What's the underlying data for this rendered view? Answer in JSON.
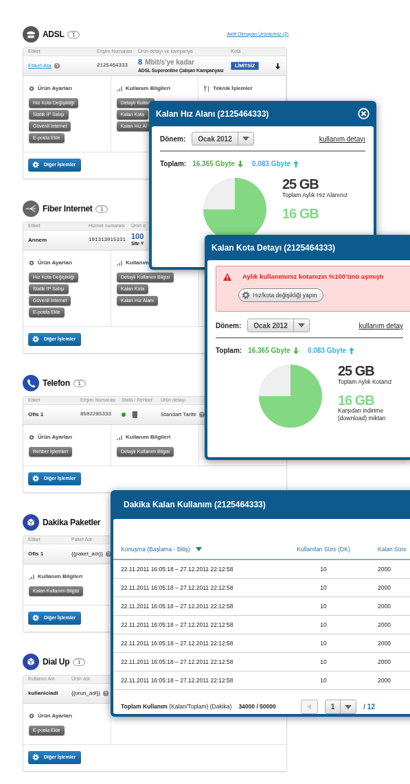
{
  "sections": [
    {
      "kind": "adsl",
      "title": "ADSL",
      "count": "1",
      "link": "Aktif Olmayan Ürünleriniz (3)",
      "columns": [
        "Etiket",
        "Erişim Numarası",
        "Ürün detayı ve kampanya",
        "Kota"
      ],
      "cells": [
        {
          "kind": "link",
          "text": "Etiket Ata",
          "help": true
        },
        {
          "kind": "number",
          "text": "2125464333"
        },
        {
          "kind": "speed",
          "value": "8",
          "unit": "Mbit/s'ye kadar",
          "campaign": "ADSL Superonline Çalışan Kampanyası"
        },
        {
          "kind": "badge",
          "text": "LİMİTSİZ"
        },
        {
          "kind": "expand"
        }
      ],
      "groups": [
        {
          "kind": "settings",
          "title": "Ürün Ayarları",
          "buttons": [
            "Hız Kota Değişikliği",
            "Statik IP Satışı",
            "Güvenli Internet",
            "E-posta Ekle"
          ]
        },
        {
          "kind": "usage",
          "title": "Kullanım Bilgileri",
          "buttons": [
            "Detaylı Kullan",
            "Kalan Kota",
            "Kalan Hız Al"
          ]
        },
        {
          "kind": "tech",
          "title": "Teknik İşlemler"
        }
      ],
      "footer_button": "Diğer İşlemler"
    },
    {
      "kind": "fiber",
      "title": "Fiber Internet",
      "count": "1",
      "columns": [
        "Etiket",
        "Hizmet numarası",
        "Ürün d"
      ],
      "cells": [
        {
          "kind": "label",
          "text": "Annem"
        },
        {
          "kind": "number",
          "text": "101313015331"
        },
        {
          "kind": "speed",
          "value": "100",
          "campaign": "Site Y"
        }
      ],
      "groups": [
        {
          "kind": "settings",
          "title": "Ürün Ayarları",
          "buttons": [
            "Hız Kota Değişikliği",
            "Statik IP Satışı",
            "Güvenli Internet",
            "E-posta Ekle"
          ]
        },
        {
          "kind": "usage",
          "title": "Kullanım",
          "buttons": [
            "Detaylı Kullanım Bilgisi",
            "Kalan Kota",
            "Kalan Hız Alanı"
          ]
        }
      ],
      "footer_button": "Diğer İşlemler"
    },
    {
      "kind": "telefon",
      "title": "Telefon",
      "count": "1",
      "columns": [
        "Etiket",
        "Erişim Numarası",
        "Statü / Rehber",
        "Ürün detayı"
      ],
      "cells": [
        {
          "kind": "label",
          "text": "Ofis 1"
        },
        {
          "kind": "number",
          "text": "8502285333"
        },
        {
          "kind": "status",
          "online": true
        },
        {
          "kind": "text",
          "text": "Standart Tarife",
          "help": true
        }
      ],
      "groups": [
        {
          "kind": "settings",
          "title": "Ürün Ayarları",
          "buttons": [
            "Rehber İşlemleri"
          ]
        },
        {
          "kind": "usage",
          "title": "Kullanım Bilgileri",
          "buttons": [
            "Detaylı Kullanım Bilgisi"
          ]
        }
      ],
      "footer_button": "Diğer İşlemler"
    },
    {
      "kind": "dakika",
      "title": "Dakika Paketler",
      "columns": [
        "Etiket",
        "Paket Adı"
      ],
      "cells": [
        {
          "kind": "label",
          "text": "Ofis 1"
        },
        {
          "kind": "text",
          "text": "{{paket_adı}}",
          "help": true
        }
      ],
      "groups": [
        {
          "kind": "usage",
          "title": "Kullanım Bilgileri",
          "buttons": [
            "Kalan Kullanım Bilgisi"
          ]
        }
      ],
      "footer_button": "Diğer İşlemler"
    },
    {
      "kind": "dialup",
      "title": "Dial Up",
      "count": "1",
      "columns": [
        "Kullanıcı Adı",
        "Ürün adı"
      ],
      "cells": [
        {
          "kind": "label",
          "text": "kullaniciadi"
        },
        {
          "kind": "text",
          "text": "{{urun_adi}}",
          "help": true
        }
      ],
      "groups": [
        {
          "kind": "settings",
          "title": "Ürün Ayarları",
          "buttons": [
            "E-posta Ekle"
          ]
        }
      ],
      "footer_button": "Diğer İşlemler"
    }
  ],
  "popups": [
    {
      "kind": "usage",
      "title": "Kalan Hız Alanı (2125464333)",
      "closable": true,
      "period_label": "Dönem:",
      "period": "Ocak 2012",
      "detail_link": "kullanım detayı",
      "total_label": "Toplam:",
      "download": "16.365 Gbyte",
      "upload": "0.083 Gbyte",
      "total": "25 GB",
      "total_caption": "Toplam Aylık Hız Alanınız",
      "used": "16 GB"
    },
    {
      "kind": "usage",
      "title": "Kalan Kota Detayı (2125464333)",
      "alert": {
        "text": "Aylık kullanımınız kotanızın %100’ünü aşmıştı",
        "button": "Hız/kota değişikliği yapın"
      },
      "period_label": "Dönem:",
      "period": "Ocak 2012",
      "detail_link": "kullanım detay",
      "total_label": "Toplam:",
      "download": "16.365 Gbyte",
      "upload": "0.083 Gbyte",
      "total": "25 GB",
      "total_caption": "Toplam Aylık Kotanız",
      "used": "16 GB",
      "used_caption": "Karşıdan indirime (download) miktarı"
    },
    {
      "kind": "table",
      "title": "Dakika Kalan Kullanım (2125464333)",
      "columns": [
        {
          "label": "Konuşma (Başlama  - Bitiş)",
          "sorted": true
        },
        {
          "label": "Kullanılan Süre (DK)",
          "sorted": false
        },
        {
          "label": "Kalan Süre",
          "sorted": false
        }
      ],
      "rows": [
        [
          "22.11.2011 16:05:18 – 27.12.2011 22:12:58",
          "10",
          "2000"
        ],
        [
          "22.11.2011 16:05:18 – 27.12.2011 22:12:58",
          "10",
          "2000"
        ],
        [
          "22.11.2011 16:05:18 – 27.12.2011 22:12:58",
          "10",
          "2000"
        ],
        [
          "22.11.2011 16:05:18 – 27.12.2011 22:12:58",
          "10",
          "2000"
        ],
        [
          "22.11.2011 16:05:18 – 27.12.2011 22:12:58",
          "10",
          "2000"
        ],
        [
          "22.11.2011 16:05:18 – 27.12.2011 22:12:58",
          "10",
          "2000"
        ],
        [
          "22.11.2011 16:05:18 – 27.12.2011 22:12:58",
          "10",
          "2000"
        ]
      ],
      "footer": {
        "label": "**Toplam Kullanım** (Kalan/Toplam) (Dakika)",
        "value": "34000 / 50000",
        "prev_disabled": true,
        "page": "1",
        "pages": "/ 12"
      }
    }
  ]
}
